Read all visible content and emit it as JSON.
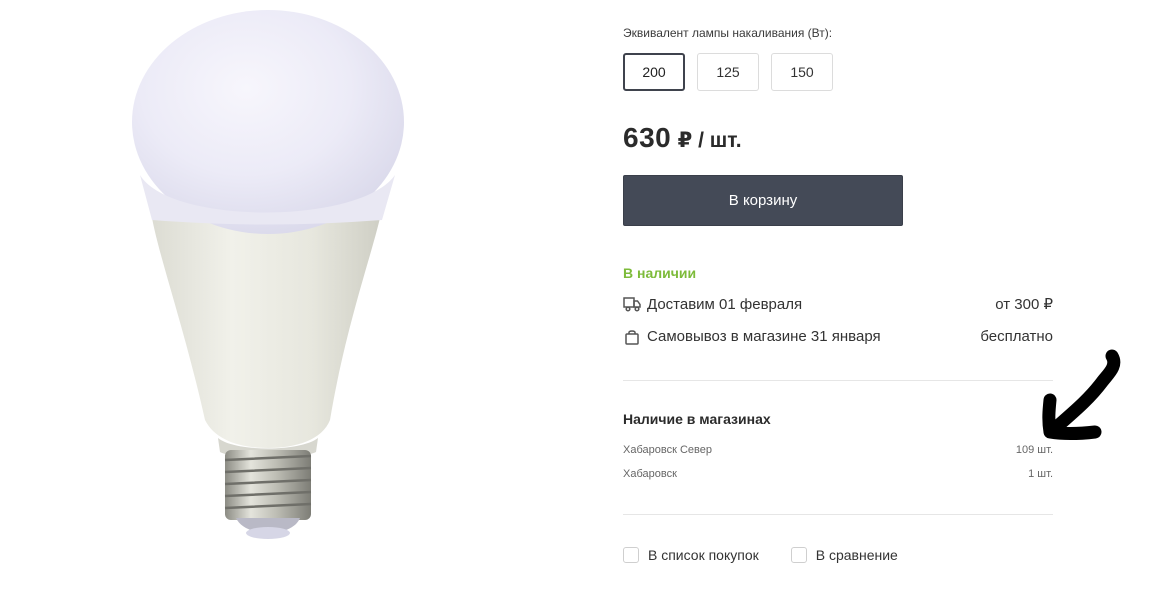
{
  "product": {
    "image_alt": "LED light bulb"
  },
  "options": {
    "label": "Эквивалент лампы накаливания (Вт):",
    "values": [
      "200",
      "125",
      "150"
    ],
    "selected": "200"
  },
  "price": {
    "amount": "630",
    "unit": "₽ / шт."
  },
  "cart_button": {
    "label": "В корзину"
  },
  "availability": {
    "status": "В наличии",
    "status_color": "#7dbb3a",
    "delivery": {
      "icon": "truck-icon",
      "text": "Доставим 01 февраля",
      "value": "от 300 ₽"
    },
    "pickup": {
      "icon": "shopping-bag-icon",
      "text": "Самовывоз в магазине 31 января",
      "value": "бесплатно"
    }
  },
  "stores": {
    "title": "Наличие в магазинах",
    "items": [
      {
        "name": "Хабаровск Север",
        "qty": "109 шт."
      },
      {
        "name": "Хабаровск",
        "qty": "1 шт."
      }
    ]
  },
  "actions": {
    "shopping_list": "В список покупок",
    "compare": "В сравнение"
  },
  "colors": {
    "button_bg": "#444a57",
    "accent_green": "#7dbb3a"
  }
}
